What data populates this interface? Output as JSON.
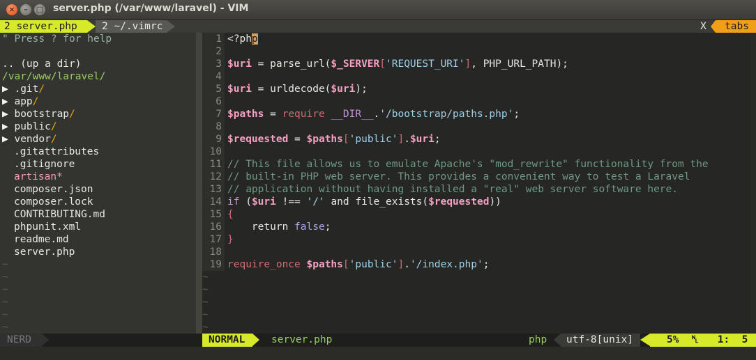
{
  "window": {
    "title": "server.php (/var/www/laravel) - VIM",
    "close_glyph": "×",
    "min_glyph": "–",
    "max_glyph": "□"
  },
  "tabline": {
    "tabs": [
      {
        "label": "2 server.php",
        "active": true
      },
      {
        "label": "2 ~/.vimrc",
        "active": false
      }
    ],
    "close_label": "X",
    "tabs_label": "tabs"
  },
  "nerdtree": {
    "help": "\" Press ? for help",
    "up_dir": ".. (up a dir)",
    "cwd": "/var/www/laravel/",
    "dirs": [
      {
        "arrow": "▶",
        "name": ".git",
        "slash": "/"
      },
      {
        "arrow": "▶",
        "name": "app",
        "slash": "/"
      },
      {
        "arrow": "▶",
        "name": "bootstrap",
        "slash": "/"
      },
      {
        "arrow": "▶",
        "name": "public",
        "slash": "/"
      },
      {
        "arrow": "▶",
        "name": "vendor",
        "slash": "/"
      }
    ],
    "files": [
      ".gitattributes",
      ".gitignore",
      "artisan*",
      "composer.json",
      "composer.lock",
      "CONTRIBUTING.md",
      "phpunit.xml",
      "readme.md",
      "server.php"
    ],
    "tilde": "~"
  },
  "editor": {
    "line_numbers": [
      "1",
      "2",
      "3",
      "4",
      "5",
      "6",
      "7",
      "8",
      "9",
      "10",
      "11",
      "12",
      "13",
      "14",
      "15",
      "16",
      "17",
      "18",
      "19"
    ],
    "lines": {
      "l1_a": "<?ph",
      "l1_cursor": "p",
      "l3_var": "$uri",
      "l3_eq": " = parse_url(",
      "l3_const": "$_SERVER",
      "l3_br1": "[",
      "l3_str": "'REQUEST_URI'",
      "l3_br2": "]",
      "l3_rest": ", PHP_URL_PATH",
      "l3_close": ");",
      "l5_var": "$uri",
      "l5_eq": " = urldecode(",
      "l5_arg": "$uri",
      "l5_close": ");",
      "l7_var": "$paths",
      "l7_eq": " = ",
      "l7_kw": "require",
      "l7_dir": " __DIR__",
      "l7_dot": ".",
      "l7_str": "'/bootstrap/paths.php'",
      "l7_end": ";",
      "l9_var": "$requested",
      "l9_eq": " = ",
      "l9_arr": "$paths",
      "l9_br1": "[",
      "l9_str": "'public'",
      "l9_br2": "]",
      "l9_dot": ".",
      "l9_uri": "$uri",
      "l9_end": ";",
      "l11": "// This file allows us to emulate Apache's \"mod_rewrite\" functionality from the",
      "l12": "// built-in PHP web server. This provides a convenient way to test a Laravel",
      "l13": "// application without having installed a \"real\" web server software here.",
      "l14_kw": "if",
      "l14_open": " (",
      "l14_var": "$uri",
      "l14_op": " !== ",
      "l14_str": "'/'",
      "l14_and": " and file_exists(",
      "l14_var2": "$requested",
      "l14_close": "))",
      "l15": "{",
      "l16_kw": "    return ",
      "l16_bool": "false",
      "l16_end": ";",
      "l17": "}",
      "l19_kw": "require_once",
      "l19_sp": " ",
      "l19_var": "$paths",
      "l19_br1": "[",
      "l19_str": "'public'",
      "l19_br2": "]",
      "l19_dot": ".",
      "l19_str2": "'/index.php'",
      "l19_end": ";"
    },
    "tilde": "~"
  },
  "statusline": {
    "nerd_label": "NERD",
    "mode": "NORMAL",
    "filename": "server.php",
    "filetype": "php",
    "encoding": "utf-8[unix]",
    "position": "5%  ␤   1:  5"
  },
  "colors": {
    "mode_bg": "#d7ea2a",
    "tabs_bg": "#f0a018",
    "variable": "#f4a0c2",
    "string": "#a0d0e8",
    "comment": "#6e9a84",
    "cwd": "#9acc64"
  }
}
